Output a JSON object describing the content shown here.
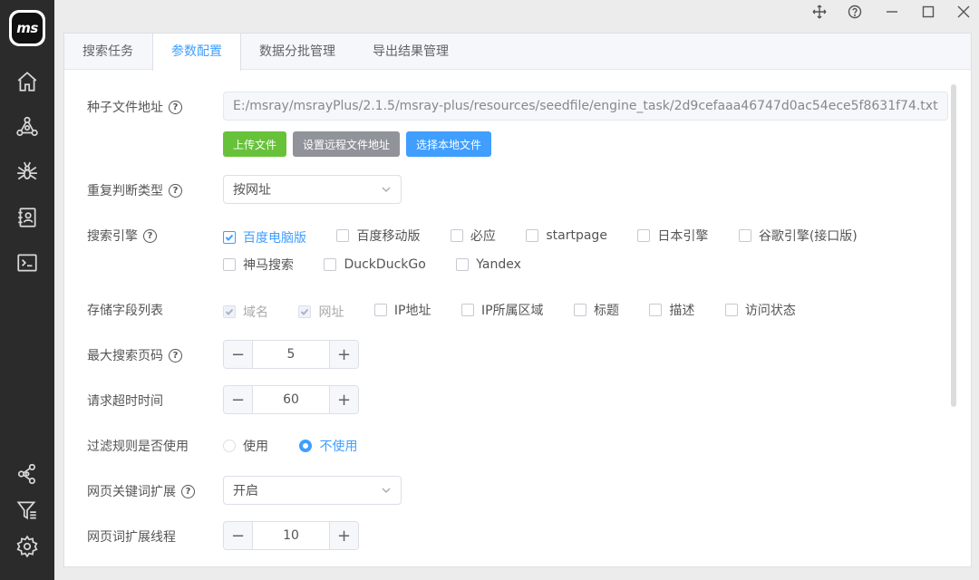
{
  "app": {
    "logo_text": "ms"
  },
  "sidebar": {
    "items": [
      {
        "name": "home",
        "icon": "home-icon"
      },
      {
        "name": "network",
        "icon": "network-icon"
      },
      {
        "name": "spider",
        "icon": "spider-icon"
      },
      {
        "name": "contacts",
        "icon": "contact-book-icon"
      },
      {
        "name": "terminal",
        "icon": "terminal-icon"
      },
      {
        "name": "share",
        "icon": "share-icon"
      },
      {
        "name": "filter",
        "icon": "filter-list-icon"
      },
      {
        "name": "settings",
        "icon": "gear-icon"
      }
    ]
  },
  "window": {
    "controls": [
      "move-icon",
      "help-icon",
      "minimize-icon",
      "maximize-icon",
      "close-icon"
    ]
  },
  "tabs": [
    {
      "label": "搜索任务",
      "active": false
    },
    {
      "label": "参数配置",
      "active": true
    },
    {
      "label": "数据分批管理",
      "active": false
    },
    {
      "label": "导出结果管理",
      "active": false
    }
  ],
  "form": {
    "seed_file": {
      "label": "种子文件地址",
      "value": "E:/msray/msrayPlus/2.1.5/msray-plus/resources/seedfile/engine_task/2d9cefaaa46747d0ac54ece5f8631f74.txt",
      "buttons": {
        "upload": "上传文件",
        "remote": "设置远程文件地址",
        "local": "选择本地文件"
      }
    },
    "dedupe": {
      "label": "重复判断类型",
      "value": "按网址"
    },
    "engines": {
      "label": "搜索引擎",
      "options": [
        {
          "label": "百度电脑版",
          "checked": true
        },
        {
          "label": "百度移动版",
          "checked": false
        },
        {
          "label": "必应",
          "checked": false
        },
        {
          "label": "startpage",
          "checked": false
        },
        {
          "label": "日本引擎",
          "checked": false
        },
        {
          "label": "谷歌引擎(接口版)",
          "checked": false
        },
        {
          "label": "神马搜索",
          "checked": false
        },
        {
          "label": "DuckDuckGo",
          "checked": false
        },
        {
          "label": "Yandex",
          "checked": false
        }
      ]
    },
    "fields": {
      "label": "存储字段列表",
      "options": [
        {
          "label": "域名",
          "checked": true,
          "disabled": true
        },
        {
          "label": "网址",
          "checked": true,
          "disabled": true
        },
        {
          "label": "IP地址",
          "checked": false,
          "disabled": false
        },
        {
          "label": "IP所属区域",
          "checked": false,
          "disabled": false
        },
        {
          "label": "标题",
          "checked": false,
          "disabled": false
        },
        {
          "label": "描述",
          "checked": false,
          "disabled": false
        },
        {
          "label": "访问状态",
          "checked": false,
          "disabled": false
        }
      ]
    },
    "max_pages": {
      "label": "最大搜索页码",
      "value": "5"
    },
    "timeout": {
      "label": "请求超时时间",
      "value": "60"
    },
    "filter_rules": {
      "label": "过滤规则是否使用",
      "options": [
        {
          "label": "使用",
          "selected": false
        },
        {
          "label": "不使用",
          "selected": true
        }
      ]
    },
    "keyword_expand": {
      "label": "网页关键词扩展",
      "value": "开启"
    },
    "expand_threads": {
      "label": "网页词扩展线程",
      "value": "10"
    }
  },
  "colors": {
    "accent": "#409eff",
    "green": "#67c23a",
    "gray": "#909399",
    "sidebar": "#2b2b2b"
  }
}
